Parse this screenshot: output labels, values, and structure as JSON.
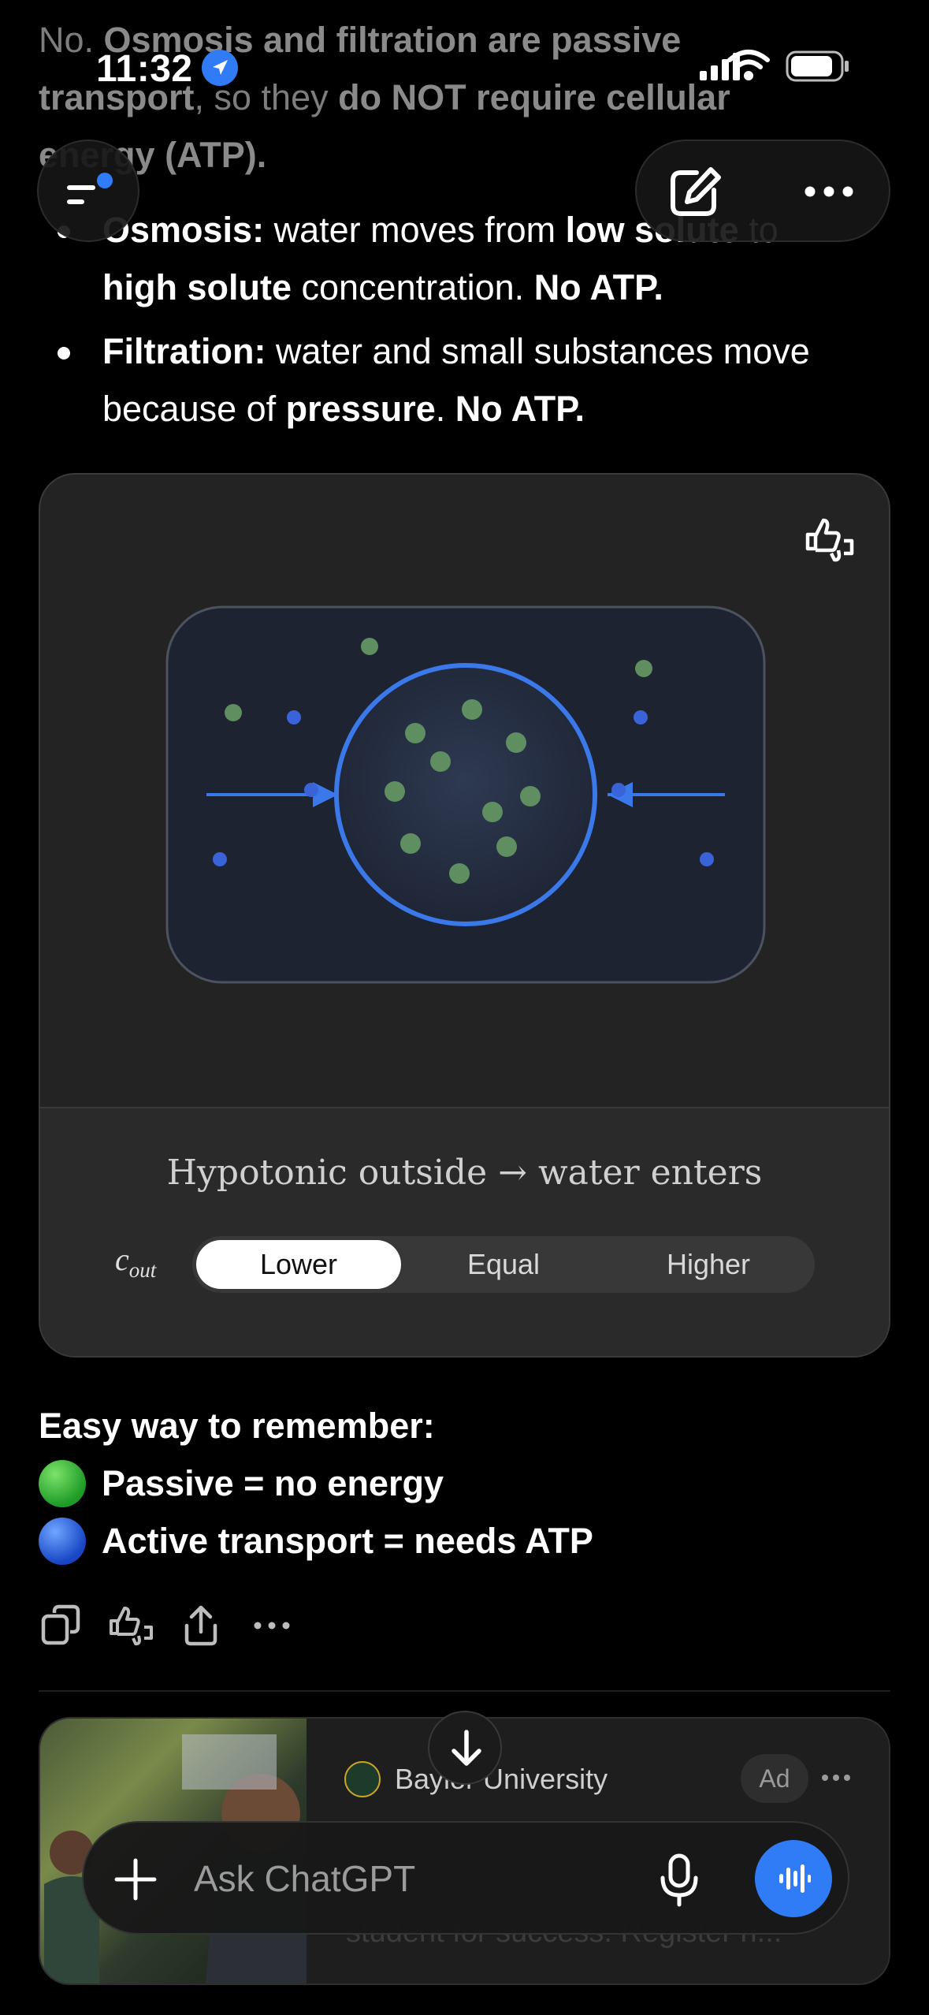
{
  "status_bar": {
    "time": "11:32"
  },
  "chat": {
    "intro_line1": {
      "pre": "No. ",
      "b1": "Osmosis and filtration are passive"
    },
    "intro_line2": {
      "b1": "transport",
      "mid": ", so they ",
      "b2": "do NOT require cellular"
    },
    "intro_line3": {
      "b1": "energy (ATP)."
    },
    "bullets": [
      {
        "label": "Osmosis:",
        "text1": " water moves from ",
        "bold1": "low solute",
        "text2": " to",
        "bold2": "high solute",
        "text3": " concentration. ",
        "bold3": "No ATP."
      },
      {
        "label": "Filtration:",
        "text1": " water and small substances move because of ",
        "bold1": "pressure",
        "text2": ". ",
        "bold2": "No ATP."
      }
    ]
  },
  "widget": {
    "caption": "Hypotonic outside → water enters",
    "variable_symbol": "c",
    "variable_sub": "out",
    "options": [
      "Lower",
      "Equal",
      "Higher"
    ],
    "selected": "Lower",
    "colors": {
      "membrane": "#3b78ea",
      "solute": "#5f8f60",
      "water": "#3a62d9"
    }
  },
  "summary": {
    "heading": "Easy way to remember:",
    "passive": "Passive = no energy",
    "active": "Active transport = needs ATP"
  },
  "ad": {
    "brand": "Baylor University",
    "badge": "Ad",
    "line": "student for success. Register n..."
  },
  "composer": {
    "placeholder": "Ask ChatGPT"
  }
}
